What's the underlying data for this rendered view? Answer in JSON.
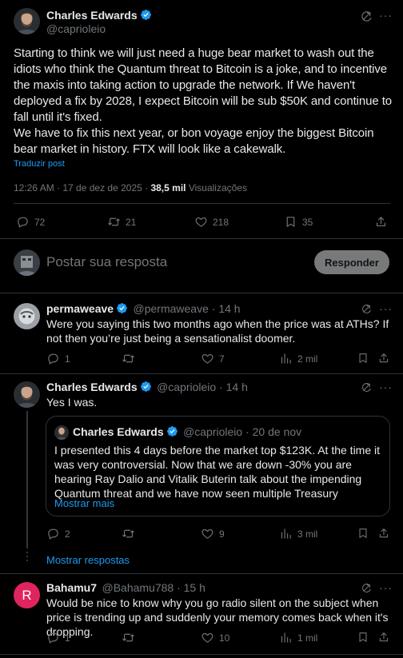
{
  "main_post": {
    "author_name": "Charles Edwards",
    "author_handle": "@caprioleio",
    "text_1": "Starting to think we will just need a huge bear market to wash out the idiots who think the Quantum threat to Bitcoin is a joke, and to incentive the maxis into taking action to upgrade the network. If We haven't deployed a fix by 2028, I expect Bitcoin will be sub $50K and continue to fall until it's fixed.",
    "text_2": "We have to fix this next year, or bon voyage enjoy the biggest Bitcoin bear market in history. FTX will look like a cakewalk.",
    "translate": "Traduzir post",
    "time": "12:26 AM · 17 de dez de 2025 · ",
    "views_count": "38,5 mil",
    "views_label": " Visualizações",
    "replies": "72",
    "reposts": "21",
    "likes": "218",
    "bookmarks": "35"
  },
  "reply_box": {
    "placeholder": "Postar sua resposta",
    "button": "Responder"
  },
  "replies": [
    {
      "author_name": "permaweave",
      "author_handle": "@permaweave · 14 h",
      "text": "Were you saying this two months ago when the price was at ATHs? If not then you’re just being a sensationalist doomer.",
      "replies": "1",
      "reposts": "",
      "likes": "7",
      "views": "2 mil"
    },
    {
      "author_name": "Charles Edwards",
      "author_handle": "@caprioleio · 14 h",
      "text": "Yes I was.",
      "replies": "2",
      "reposts": "",
      "likes": "9",
      "views": "3 mil",
      "quote": {
        "author_name": "Charles Edwards",
        "author_handle": "@caprioleio · 20 de nov",
        "text": "I presented this 4 days before the market top $123K. At the time it was very controversial. Now that we are down -30% you are hearing Ray Dalio and Vitalik Buterin talk about the impending Quantum threat and we have now seen multiple Treasury Companies start to nuke their",
        "more": "Mostrar mais"
      }
    },
    {
      "author_name": "Bahamu7",
      "author_handle": "@Bahamu788 · 15 h",
      "avatar_letter": "R",
      "text": "Would be nice to know why you go radio silent on the subject when price is trending up and suddenly your memory comes back when it's dropping.",
      "replies": "1",
      "reposts": "",
      "likes": "10",
      "views": "1 mil"
    }
  ],
  "show_replies": "Mostrar respostas",
  "colors": {
    "accent": "#1d9bf0",
    "background": "#000000",
    "text": "#e7e9ea",
    "muted": "#71767b",
    "divider": "#2f3336",
    "avatar_r": "#e0245e"
  }
}
